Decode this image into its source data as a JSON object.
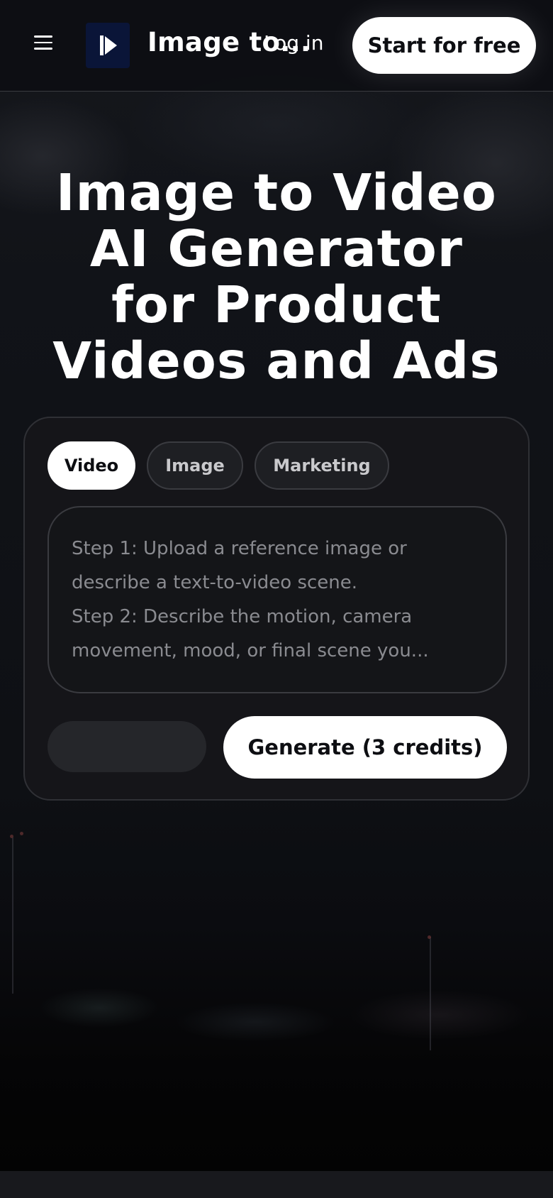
{
  "header": {
    "menu_icon": "hamburger-menu-icon",
    "logo_icon": "play-logo-icon",
    "brand": "Image to...",
    "login_label": "Log in",
    "cta_label": "Start for free"
  },
  "hero": {
    "title_lines": [
      "Image to Video",
      "AI Generator",
      "for Product",
      "Videos and Ads"
    ]
  },
  "generator": {
    "tabs": [
      {
        "label": "Video",
        "active": true
      },
      {
        "label": "Image",
        "active": false
      },
      {
        "label": "Marketing",
        "active": false
      }
    ],
    "prompt_placeholder_lines": [
      "Step 1: Upload a reference image or",
      "describe a text-to-video scene.",
      "Step 2: Describe the motion, camera",
      "movement, mood, or final scene you..."
    ],
    "generate_label": "Generate (3 credits)"
  },
  "colors": {
    "background": "#0d0e12",
    "logo_bg": "#0a1538",
    "button_bg": "#ffffff",
    "button_text": "#0d0e12"
  }
}
